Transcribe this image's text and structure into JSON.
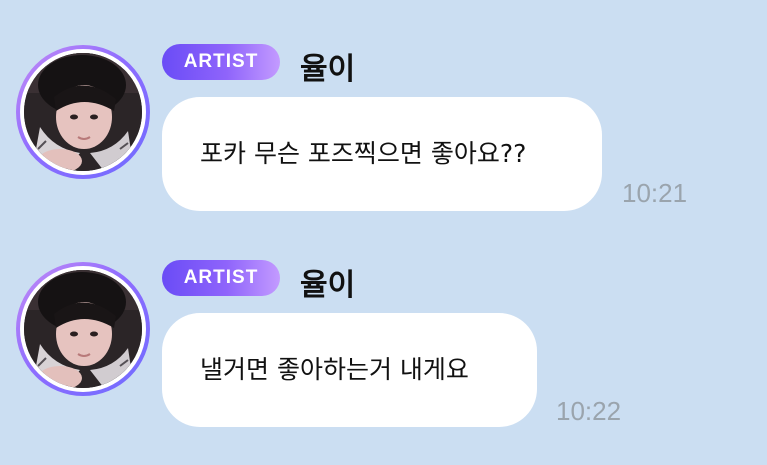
{
  "messages": [
    {
      "badge": "ARTIST",
      "sender": "율이",
      "text": "포카 무슨 포즈찍으면 좋아요??",
      "time": "10:21",
      "avatar_icon": "profile-photo"
    },
    {
      "badge": "ARTIST",
      "sender": "율이",
      "text": "낼거면 좋아하는거 내게요",
      "time": "10:22",
      "avatar_icon": "profile-photo"
    }
  ],
  "colors": {
    "background": "#cbdef2",
    "bubble": "#ffffff",
    "badge_start": "#6a4cf6",
    "badge_end": "#c39bff",
    "time": "#9aa4ad"
  }
}
